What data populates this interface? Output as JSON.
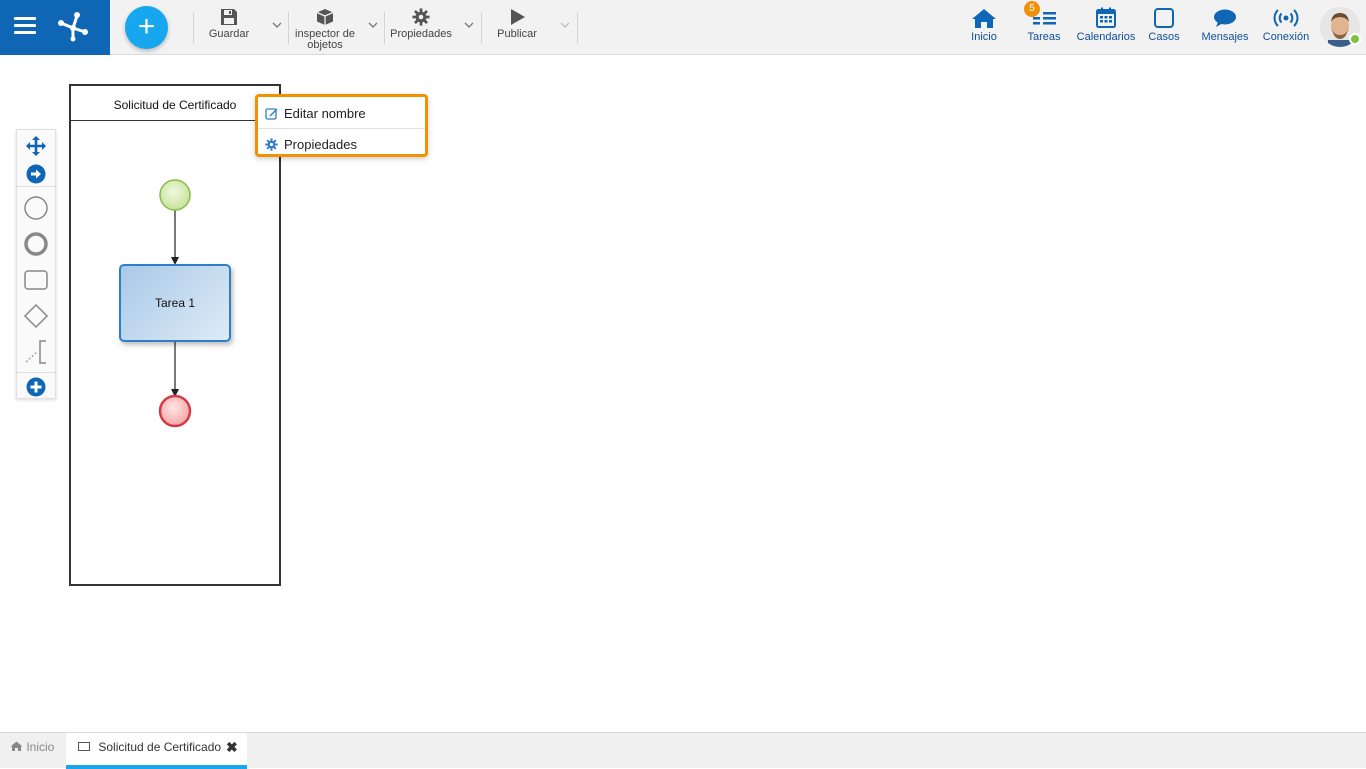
{
  "toolbar": {
    "add_label": "+",
    "tools": [
      {
        "label": "Guardar",
        "icon": "save-icon"
      },
      {
        "label_line1": "inspector de",
        "label_line2": "objetos",
        "icon": "cube-icon"
      },
      {
        "label": "Propiedades",
        "icon": "gear-icon"
      },
      {
        "label": "Publicar",
        "icon": "play-icon"
      }
    ]
  },
  "nav": {
    "items": [
      {
        "label": "Inicio",
        "icon": "home-icon"
      },
      {
        "label": "Tareas",
        "icon": "tasks-icon",
        "badge": "5"
      },
      {
        "label": "Calendarios",
        "icon": "calendar-icon"
      },
      {
        "label": "Casos",
        "icon": "case-icon"
      },
      {
        "label": "Mensajes",
        "icon": "chat-icon"
      },
      {
        "label": "Conexión",
        "icon": "signal-icon"
      }
    ],
    "status_color": "#7cc23a"
  },
  "palette": {
    "items": [
      "move-icon",
      "connect-icon",
      "start-event-icon",
      "end-event-icon",
      "task-icon",
      "gateway-icon",
      "annotation-icon",
      "add-icon"
    ]
  },
  "pool": {
    "title": "Solicitud de Certificado"
  },
  "task": {
    "label": "Tarea 1"
  },
  "context_menu": {
    "items": [
      {
        "label": "Editar nombre",
        "icon": "edit-icon"
      },
      {
        "label": "Propiedades",
        "icon": "gear-icon"
      }
    ],
    "border_color": "#f39200"
  },
  "bottom_tabs": {
    "home_label": "Inicio",
    "active_label": "Solicitud de Certificado",
    "close_symbol": "✖"
  },
  "colors": {
    "brand": "#0f66b5",
    "accent": "#17a7ee",
    "badge": "#f0900c"
  }
}
